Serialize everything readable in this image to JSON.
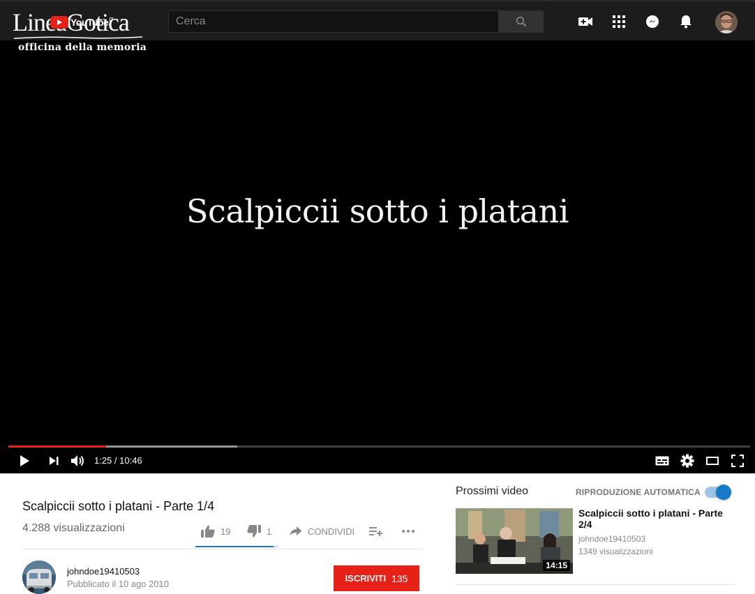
{
  "header": {
    "logo_text": "LineaGotica",
    "logo_subtitle": "officina della memoria",
    "yt_logo_text": "YouTube",
    "yt_logo_region": "IT",
    "search_placeholder": "Cerca",
    "icons": [
      "upload-video-icon",
      "apps-grid-icon",
      "messages-icon",
      "notifications-bell-icon",
      "account-avatar"
    ]
  },
  "player": {
    "screen_text": "Scalpiccii sotto i platani",
    "current_time": "1:25",
    "separator": " / ",
    "duration": "10:46",
    "progress_fraction": 0.132,
    "buffered_fraction": 0.309,
    "controls": [
      "play-icon",
      "next-icon",
      "volume-icon",
      "subtitles-icon",
      "settings-gear-icon",
      "theater-mode-icon",
      "fullscreen-icon"
    ]
  },
  "video": {
    "title": "Scalpiccii sotto i platani - Parte 1/4",
    "views": "4.288 visualizzazioni",
    "likes": "19",
    "dislikes": "1",
    "like_ratio": 0.95,
    "share_label": "CONDIVIDI"
  },
  "channel": {
    "name": "johndoe19410503",
    "published": "Pubblicato il 10 ago 2010",
    "subscribe_label": "ISCRIVITI",
    "subscriber_count": "135"
  },
  "sidebar": {
    "heading": "Prossimi video",
    "autoplay_label": "RIPRODUZIONE AUTOMATICA",
    "autoplay_on": true,
    "items": [
      {
        "title": "Scalpiccii sotto i platani - Parte 2/4",
        "channel": "johndoe19410503",
        "views": "1349 visualizzazioni",
        "duration": "14:15"
      }
    ]
  },
  "colors": {
    "accent_red": "#e62117",
    "accent_blue": "#167ac6",
    "topbar_bg": "#1c1c1c"
  }
}
